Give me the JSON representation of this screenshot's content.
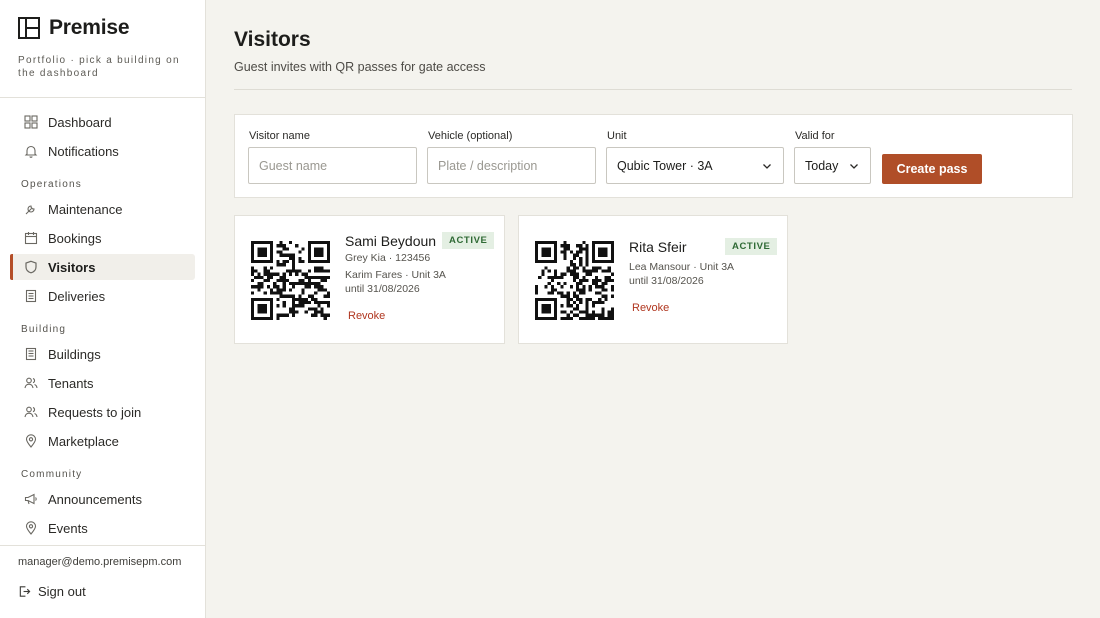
{
  "brand": {
    "name": "Premise",
    "subtitle": "Portfolio · pick a building on the dashboard"
  },
  "sidebar": {
    "top_items": [
      {
        "label": "Dashboard",
        "icon": "grid-icon"
      },
      {
        "label": "Notifications",
        "icon": "bell-icon"
      }
    ],
    "sections": [
      {
        "title": "Operations",
        "items": [
          {
            "label": "Maintenance",
            "icon": "wrench-icon"
          },
          {
            "label": "Bookings",
            "icon": "calendar-icon"
          },
          {
            "label": "Visitors",
            "icon": "shield-icon",
            "active": true
          },
          {
            "label": "Deliveries",
            "icon": "clipboard-icon"
          }
        ]
      },
      {
        "title": "Building",
        "items": [
          {
            "label": "Buildings",
            "icon": "building-icon"
          },
          {
            "label": "Tenants",
            "icon": "users-icon"
          },
          {
            "label": "Requests to join",
            "icon": "user-plus-icon"
          },
          {
            "label": "Marketplace",
            "icon": "map-pin-icon"
          }
        ]
      },
      {
        "title": "Community",
        "items": [
          {
            "label": "Announcements",
            "icon": "megaphone-icon"
          },
          {
            "label": "Events",
            "icon": "location-icon"
          }
        ]
      }
    ],
    "user_email": "manager@demo.premisepm.com",
    "sign_out": "Sign out"
  },
  "page": {
    "title": "Visitors",
    "subtitle": "Guest invites with QR passes for gate access"
  },
  "form": {
    "visitor_name": {
      "label": "Visitor name",
      "placeholder": "Guest name",
      "value": ""
    },
    "vehicle": {
      "label": "Vehicle (optional)",
      "placeholder": "Plate / description",
      "value": ""
    },
    "unit": {
      "label": "Unit",
      "value": "Qubic Tower · 3A"
    },
    "valid_for": {
      "label": "Valid for",
      "value": "Today"
    },
    "create_label": "Create pass"
  },
  "passes": [
    {
      "name": "Sami Beydoun",
      "status": "ACTIVE",
      "vehicle": "Grey Kia · 123456",
      "host": "Karim Fares · Unit 3A",
      "valid_until": "until 31/08/2026",
      "revoke": "Revoke"
    },
    {
      "name": "Rita Sfeir",
      "status": "ACTIVE",
      "vehicle": "",
      "host": "Lea Mansour · Unit 3A",
      "valid_until": "until 31/08/2026",
      "revoke": "Revoke"
    }
  ],
  "colors": {
    "accent": "#b04e28",
    "active_badge_bg": "#e4efe3",
    "active_badge_text": "#2f6a35",
    "revoke": "#b0361f",
    "background": "#f4f3ee"
  }
}
